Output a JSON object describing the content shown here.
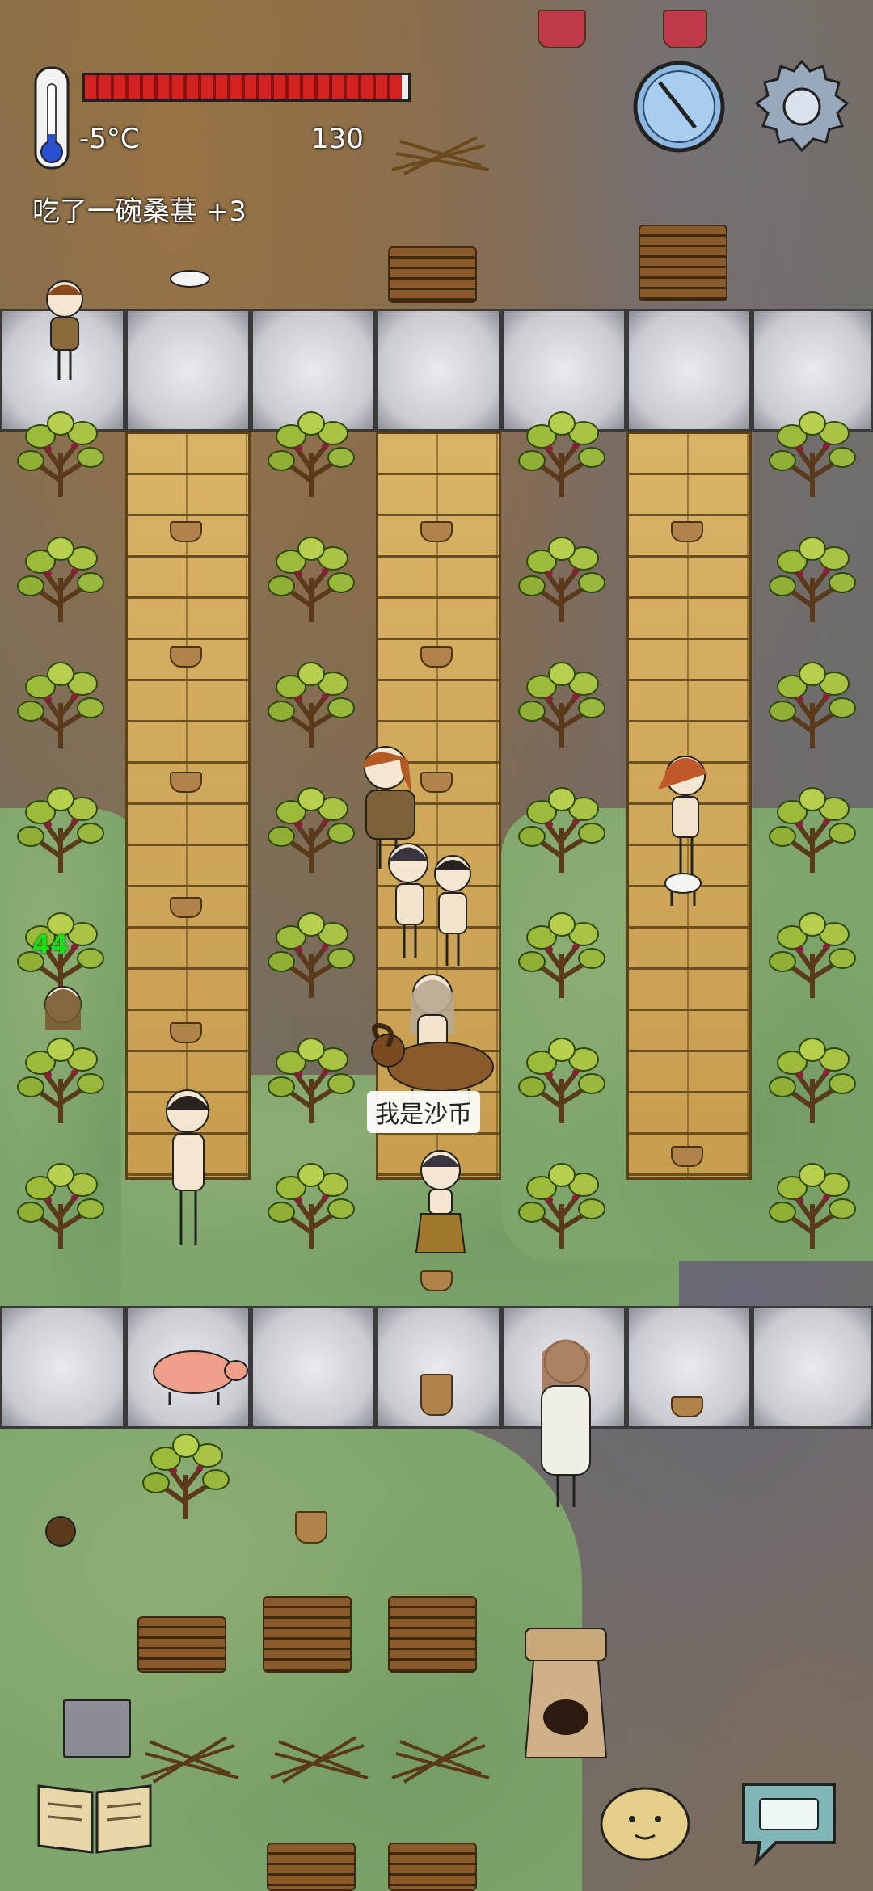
{
  "hud": {
    "temperature": "-5°C",
    "score": "130",
    "message": "吃了一碗桑葚 +3",
    "hunger_fraction": 0.98
  },
  "speech_bubble": "我是沙币",
  "floating_number": "44",
  "colors": {
    "hunger_bar": "#d32222",
    "grass": "#7ea56c",
    "plank": "#d9b366",
    "stone": "#d5d7dc"
  },
  "icons": {
    "thermometer": "thermometer-icon",
    "compass": "compass-icon",
    "settings": "gear-icon",
    "journal": "book-icon",
    "emote": "face-icon",
    "keyboard": "keyboard-icon"
  }
}
